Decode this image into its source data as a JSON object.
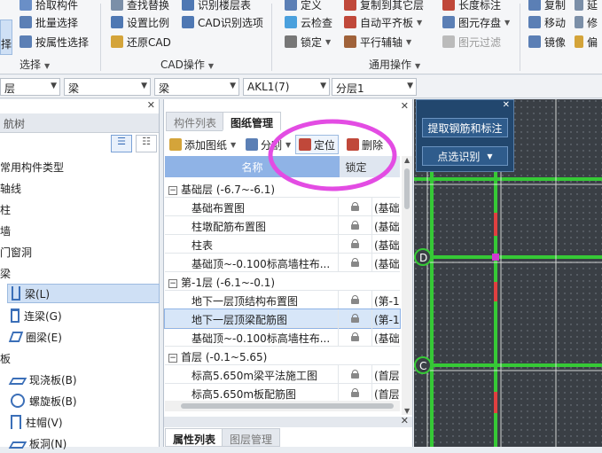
{
  "ribbon": {
    "left_partial": "择",
    "group1": {
      "items": [
        "拾取构件",
        "批量选择",
        "按属性选择"
      ],
      "label": "选择"
    },
    "group2": {
      "items": [
        "查找替换",
        "设置比例",
        "还原CAD",
        "识别楼层表",
        "CAD识别选项"
      ],
      "label": "CAD操作"
    },
    "group3": {
      "items": [
        "定义",
        "云检查",
        "锁定",
        "复制到其它层",
        "自动平齐板",
        "平行辅轴",
        "长度标注",
        "图元存盘",
        "图元过滤"
      ],
      "label": "通用操作"
    },
    "group4": {
      "items": [
        "复制",
        "移动",
        "镜像",
        "延",
        "修",
        "偏"
      ]
    }
  },
  "filterbar": {
    "floor_partial": "层",
    "type": "梁",
    "subtype": "梁",
    "component": "AKL1(7)",
    "layer": "分层1"
  },
  "left_panel": {
    "title_partial": "航树",
    "items": [
      "常用构件类型",
      "轴线",
      "柱",
      "墙",
      "门窗洞",
      "梁",
      "梁(L)",
      "连梁(G)",
      "圈梁(E)",
      "板",
      "现浇板(B)",
      "螺旋板(B)",
      "柱帽(V)",
      "板洞(N)"
    ]
  },
  "mid_panel": {
    "tabs": [
      "构件列表",
      "图纸管理"
    ],
    "toolbar": {
      "add": "添加图纸",
      "split": "分割",
      "locate": "定位",
      "delete": "删除"
    },
    "columns": {
      "name": "名称",
      "lock": "锁定"
    },
    "rows": [
      {
        "type": "group",
        "name": "基础层 (-6.7~-6.1)"
      },
      {
        "type": "item",
        "name": "基础布置图",
        "floor": "(基础"
      },
      {
        "type": "item",
        "name": "柱墩配筋布置图",
        "floor": "(基础"
      },
      {
        "type": "item",
        "name": "柱表",
        "floor": "(基础"
      },
      {
        "type": "item",
        "name": "基础顶~-0.100标高墙柱布...",
        "floor": "(基础"
      },
      {
        "type": "group",
        "name": "第-1层 (-6.1~-0.1)"
      },
      {
        "type": "item",
        "name": "地下一层顶结构布置图",
        "floor": "(第-1"
      },
      {
        "type": "item",
        "name": "地下一层顶梁配筋图",
        "floor": "(第-1",
        "selected": true
      },
      {
        "type": "item",
        "name": "基础顶~-0.100标高墙柱布...",
        "floor": "(基础"
      },
      {
        "type": "group",
        "name": "首层 (-0.1~5.65)"
      },
      {
        "type": "item",
        "name": "标高5.650m梁平法施工图",
        "floor": "(首层"
      },
      {
        "type": "item",
        "name": "标高5.650m板配筋图",
        "floor": "(首层"
      }
    ],
    "bottom_tabs": [
      "属性列表",
      "图层管理"
    ]
  },
  "cad": {
    "float_buttons": [
      "提取钢筋和标注",
      "点选识别"
    ],
    "axis_labels": [
      "D",
      "C"
    ]
  },
  "colors": {
    "accent_blue": "#8fb3e6",
    "annotation_magenta": "#e34ce3",
    "cad_green": "#36c936",
    "cad_bg": "#3a3f45"
  }
}
